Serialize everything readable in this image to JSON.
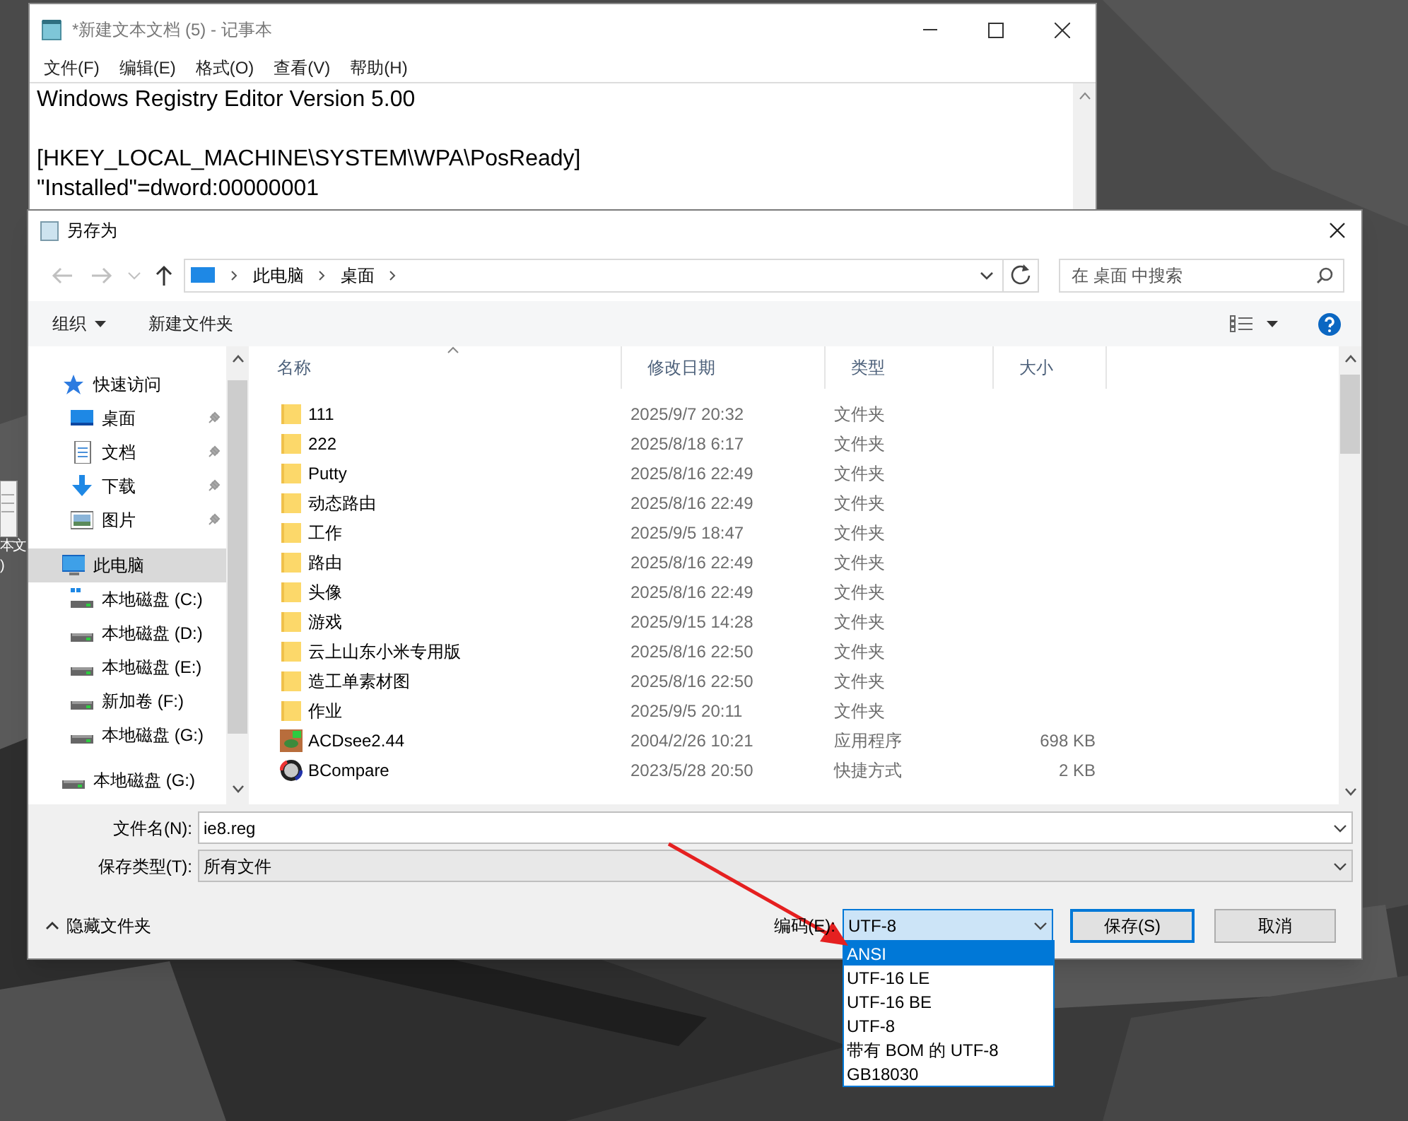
{
  "desktop_icon": {
    "label_lines": [
      "本文",
      ")"
    ]
  },
  "notepad": {
    "title": "*新建文本文档 (5) - 记事本",
    "menu": [
      "文件(F)",
      "编辑(E)",
      "格式(O)",
      "查看(V)",
      "帮助(H)"
    ],
    "paragraphs": [
      [
        "Windows Registry Editor Version 5.00"
      ],
      [
        "[HKEY_LOCAL_MACHINE\\SYSTEM\\WPA\\PosReady]",
        "\"Installed\"=dword:00000001"
      ]
    ]
  },
  "save_dialog": {
    "title": "另存为",
    "breadcrumb": [
      "此电脑",
      "桌面"
    ],
    "search": {
      "placeholder": "在 桌面 中搜索"
    },
    "toolbar": {
      "organize": "组织",
      "new_folder": "新建文件夹"
    },
    "nav": [
      {
        "label": "快速访问",
        "kind": "star",
        "selected": false,
        "children": [
          {
            "label": "桌面",
            "kind": "desktop",
            "pinned": true,
            "selected": false
          },
          {
            "label": "文档",
            "kind": "doc",
            "pinned": true,
            "selected": false
          },
          {
            "label": "下载",
            "kind": "download",
            "pinned": true,
            "selected": false
          },
          {
            "label": "图片",
            "kind": "picture",
            "pinned": true,
            "selected": false
          }
        ]
      },
      {
        "label": "此电脑",
        "kind": "pc",
        "selected": true,
        "children": [
          {
            "label": "本地磁盘 (C:)",
            "kind": "windrive",
            "pinned": false,
            "selected": false
          },
          {
            "label": "本地磁盘 (D:)",
            "kind": "drive",
            "pinned": false,
            "selected": false
          },
          {
            "label": "本地磁盘 (E:)",
            "kind": "drive",
            "pinned": false,
            "selected": false
          },
          {
            "label": "新加卷 (F:)",
            "kind": "drive",
            "pinned": false,
            "selected": false
          },
          {
            "label": "本地磁盘 (G:)",
            "kind": "drive",
            "pinned": false,
            "selected": false
          }
        ]
      },
      {
        "label": "本地磁盘 (G:)",
        "kind": "drive",
        "selected": false
      }
    ],
    "columns": [
      "名称",
      "修改日期",
      "类型",
      "大小"
    ],
    "rows": [
      {
        "name": "111",
        "date": "2025/9/7 20:32",
        "type": "文件夹",
        "kind": "folder"
      },
      {
        "name": "222",
        "date": "2025/8/18 6:17",
        "type": "文件夹",
        "kind": "folder"
      },
      {
        "name": "Putty",
        "date": "2025/8/16 22:49",
        "type": "文件夹",
        "kind": "folder"
      },
      {
        "name": "动态路由",
        "date": "2025/8/16 22:49",
        "type": "文件夹",
        "kind": "folder"
      },
      {
        "name": "工作",
        "date": "2025/9/5 18:47",
        "type": "文件夹",
        "kind": "folder"
      },
      {
        "name": "路由",
        "date": "2025/8/16 22:49",
        "type": "文件夹",
        "kind": "folder"
      },
      {
        "name": "头像",
        "date": "2025/8/16 22:49",
        "type": "文件夹",
        "kind": "folder"
      },
      {
        "name": "游戏",
        "date": "2025/9/15 14:28",
        "type": "文件夹",
        "kind": "folder"
      },
      {
        "name": "云上山东小米专用版",
        "date": "2025/8/16 22:50",
        "type": "文件夹",
        "kind": "folder"
      },
      {
        "name": "造工单素材图",
        "date": "2025/8/16 22:50",
        "type": "文件夹",
        "kind": "folder"
      },
      {
        "name": "作业",
        "date": "2025/9/5 20:11",
        "type": "文件夹",
        "kind": "folder"
      },
      {
        "name": "ACDsee2.44",
        "date": "2004/2/26 10:21",
        "type": "应用程序",
        "size": "698 KB",
        "kind": "app"
      },
      {
        "name": "BCompare",
        "date": "2023/5/28 20:50",
        "type": "快捷方式",
        "size": "2 KB",
        "kind": "shortcut"
      }
    ],
    "filename": {
      "label": "文件名(N):",
      "value": "ie8.reg"
    },
    "filetype": {
      "label": "保存类型(T):",
      "value": "所有文件"
    },
    "hide_folders": "隐藏文件夹",
    "encoding": {
      "label": "编码(E):",
      "value": "UTF-8",
      "options": [
        {
          "label": "ANSI",
          "highlighted": true
        },
        {
          "label": "UTF-16 LE",
          "highlighted": false
        },
        {
          "label": "UTF-16 BE",
          "highlighted": false
        },
        {
          "label": "UTF-8",
          "highlighted": false
        },
        {
          "label": "带有 BOM 的 UTF-8",
          "highlighted": false
        },
        {
          "label": "GB18030",
          "highlighted": false
        }
      ]
    },
    "buttons": {
      "save": "保存(S)",
      "cancel": "取消"
    }
  }
}
